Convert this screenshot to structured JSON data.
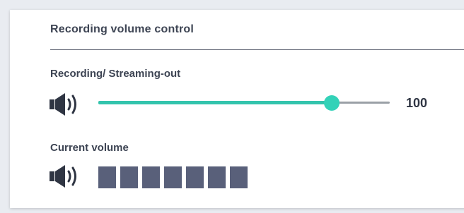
{
  "panel": {
    "title": "Recording volume control"
  },
  "recording": {
    "label": "Recording/ Streaming-out",
    "icon": "speaker-icon",
    "slider_fraction": 0.8,
    "value": "100",
    "colors": {
      "fill": "#33c4ad",
      "thumb": "#33d2b8",
      "track": "#9aa0a6"
    }
  },
  "current": {
    "label": "Current volume",
    "icon": "speaker-icon",
    "meter_segments": 7,
    "meter_color": "#59607a"
  }
}
